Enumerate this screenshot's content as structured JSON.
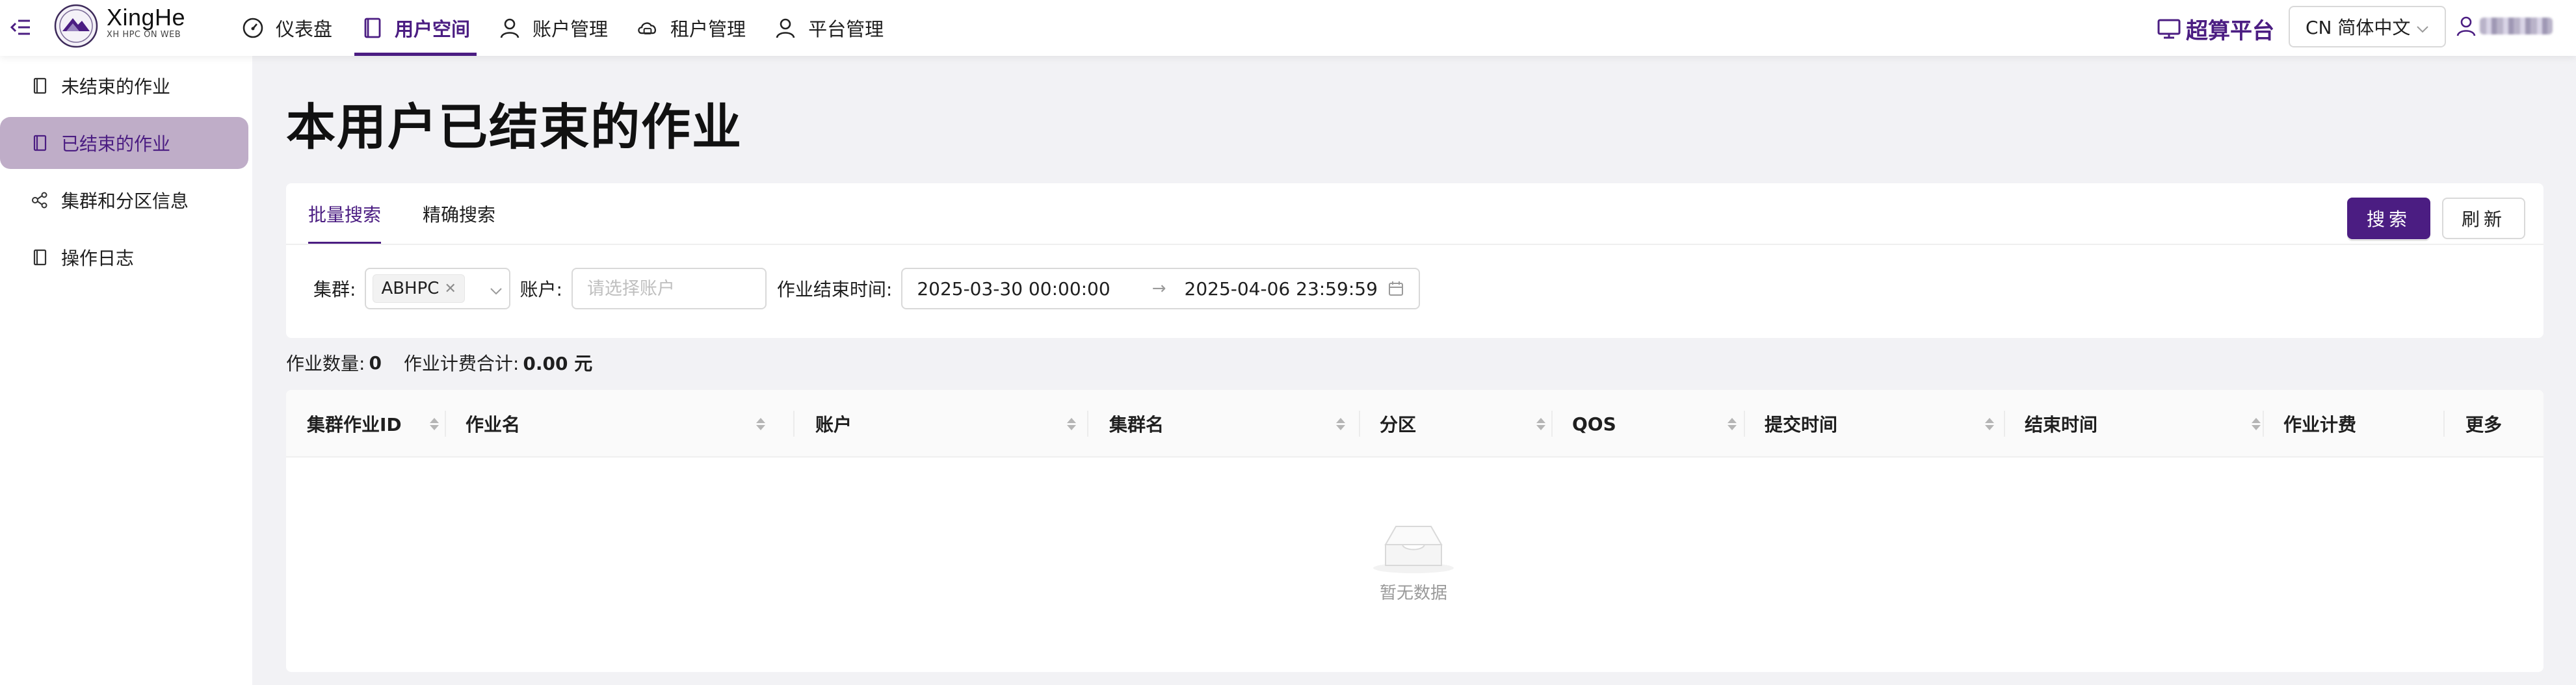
{
  "header": {
    "brand_title": "XingHe",
    "brand_subtitle": "XH HPC ON WEB",
    "nav": [
      {
        "label": "仪表盘",
        "icon": "dashboard-icon"
      },
      {
        "label": "用户空间",
        "icon": "book-icon",
        "active": true
      },
      {
        "label": "账户管理",
        "icon": "user-icon"
      },
      {
        "label": "租户管理",
        "icon": "cloud-icon"
      },
      {
        "label": "平台管理",
        "icon": "user-icon"
      }
    ],
    "platform_label": "超算平台",
    "language": "CN 简体中文",
    "accent_color": "#4b1d82"
  },
  "sidebar": {
    "items": [
      {
        "label": "未结束的作业",
        "icon": "book-icon"
      },
      {
        "label": "已结束的作业",
        "icon": "book-icon",
        "active": true
      },
      {
        "label": "集群和分区信息",
        "icon": "cluster-icon"
      },
      {
        "label": "操作日志",
        "icon": "book-icon"
      }
    ]
  },
  "main": {
    "page_title": "本用户已结束的作业",
    "tabs": [
      {
        "label": "批量搜索",
        "active": true
      },
      {
        "label": "精确搜索"
      }
    ],
    "search_button": "搜索",
    "refresh_button": "刷新",
    "filters": {
      "cluster_label": "集群:",
      "cluster_selected": "ABHPC",
      "account_label": "账户:",
      "account_placeholder": "请选择账户",
      "end_time_label": "作业结束时间:",
      "start_date": "2025-03-30 00:00:00",
      "end_date": "2025-04-06 23:59:59"
    },
    "stats": {
      "job_count_label": "作业数量:",
      "job_count": "0",
      "cost_label": "作业计费合计:",
      "cost_value": "0.00 元"
    },
    "table": {
      "columns": [
        "集群作业ID",
        "作业名",
        "账户",
        "集群名",
        "分区",
        "QOS",
        "提交时间",
        "结束时间",
        "作业计费",
        "更多"
      ],
      "rows": [],
      "empty_text": "暂无数据"
    }
  }
}
